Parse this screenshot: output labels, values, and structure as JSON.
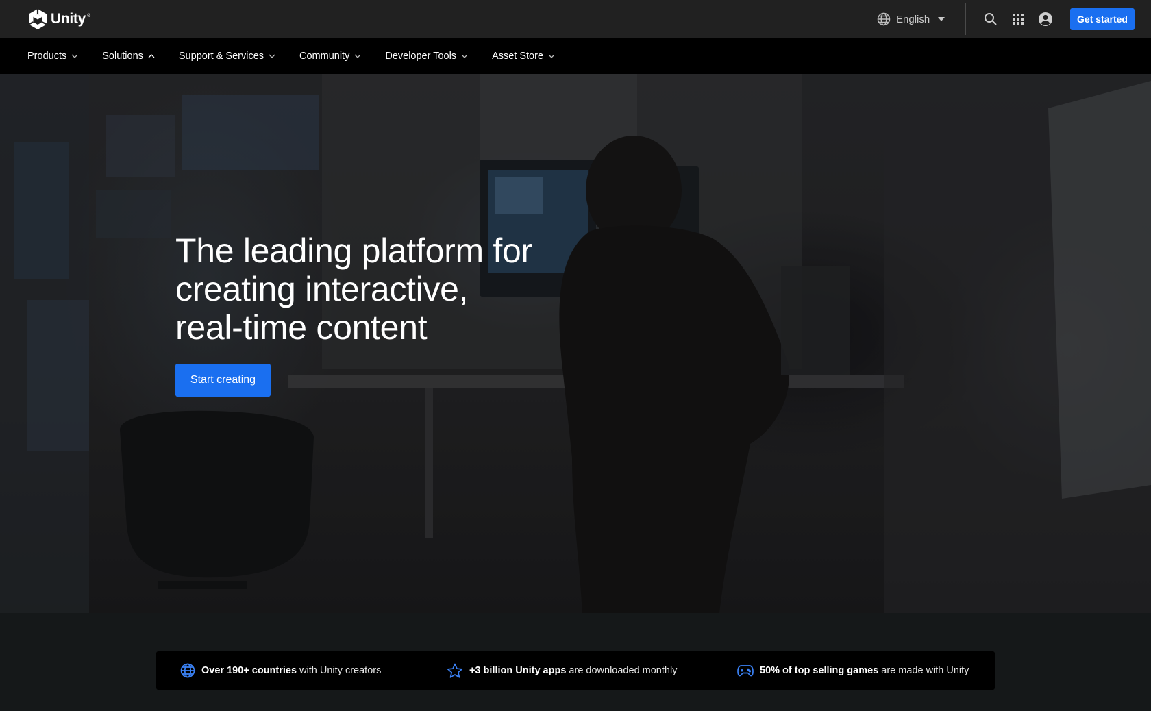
{
  "header": {
    "logo_text": "Unity",
    "logo_mark": "®",
    "language": "English",
    "icons": [
      "globe-icon",
      "search-icon",
      "apps-grid-icon",
      "account-icon"
    ],
    "cta_label": "Get started"
  },
  "nav": {
    "items": [
      {
        "label": "Products",
        "expanded": false
      },
      {
        "label": "Solutions",
        "expanded": true
      },
      {
        "label": "Support & Services",
        "expanded": false
      },
      {
        "label": "Community",
        "expanded": false
      },
      {
        "label": "Developer Tools",
        "expanded": false
      },
      {
        "label": "Asset Store",
        "expanded": false
      }
    ]
  },
  "hero": {
    "title_lines": [
      "The leading platform for",
      "creating interactive,",
      "real-time content"
    ],
    "cta_label": "Start creating"
  },
  "stats": [
    {
      "icon": "globe-icon",
      "bold": "Over 190+ countries",
      "rest": " with Unity creators"
    },
    {
      "icon": "star-icon",
      "bold": "+3 billion Unity apps",
      "rest": " are downloaded monthly"
    },
    {
      "icon": "gamepad-icon",
      "bold": "50% of top selling games",
      "rest": " are made with Unity"
    }
  ],
  "colors": {
    "accent": "#1a6ff0",
    "topbar": "#212121",
    "nav": "#000000",
    "page_bg": "#151819",
    "stat_icon": "#3b82f6"
  }
}
